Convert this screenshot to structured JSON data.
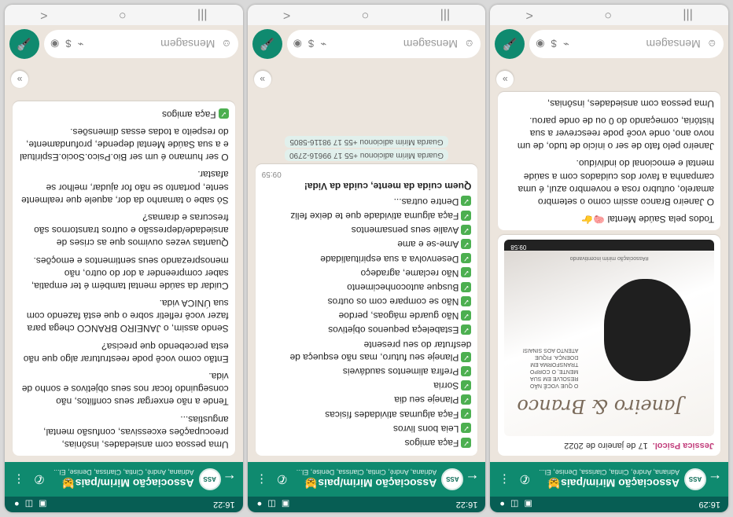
{
  "common": {
    "group_title": "Associação Mirim/pais😸",
    "members": "Adriana, André, Cintia, Clarissa, Denise, El...",
    "avatar_text": "ASS",
    "input_placeholder": "Mensagem",
    "nav": {
      "menu": "|||",
      "home": "○",
      "back": "<"
    }
  },
  "phones": [
    {
      "status_time": "16:29",
      "sender": "Jessica Psicol.",
      "date": "17 de janeiro de 2022",
      "poster": {
        "script": "Janeiro & Branco",
        "text": "O QUE VOCÊ NÃO RESOLVE EM SUA MENTE, O CORPO TRANSFORMA EM DOENÇA. FIQUE ATENTO AOS SINAIS!",
        "footer": "#Associação mirim incentivando",
        "time": "09:58"
      },
      "heading": "Todos pela Saúde Mental 🧠👉",
      "text": "O Janeiro Branco assim como o setembro amarelo, outubro rosa e novembro azul, é uma campanha a favor dos cuidados com a saúde mental e emocional do indivíduo.",
      "text2": "Janeiro pelo fato de ser o início de tudo, de um novo ano, onde você pode reescrever a sua história, começando do 0 ou de onde parou.",
      "text3": "Uma pessoa com ansiedades, insônias,"
    },
    {
      "status_time": "16:22",
      "list": [
        "Faça amigos",
        "Leia bons livros",
        "Faça algumas atividades físicas",
        "Planeje seu dia",
        "Sorria",
        "Prefira alimentos saudáveis",
        "Planeje seu futuro, mas não esqueça de desfrutar do seu presente",
        "Estabeleça pequenos objetivos",
        "Não guarde mágoas, perdoe",
        "Não se compare com os outros",
        "Busque autoconhecimento",
        "Não reclame, agradeço",
        "Desenvolva a sua espiritualidade",
        "Ame-se e ame",
        "Avalie seus pensamentos",
        "Faça alguma atividade que te deixe feliz",
        "Dentre outras..."
      ],
      "closing": "Quem cuida da mente, cuida da Vida!",
      "time": "09:59",
      "system1": "Guarda Mirim adicionou +55 17 99616-2790",
      "system2": "Guarda Mirim adicionou +55 17 98116-5805"
    },
    {
      "status_time": "16:22",
      "paras": [
        "Uma pessoa com ansiedades, insônias, preocupações excessivas, confusão mental, angustias...",
        "Tende a não enxergar seus conflitos, não conseguindo focar nos seus objetivos e sonho de vida.",
        "Então como você pode reestruturar algo que não esta percebendo que precisa?",
        "Sendo assim, o JANEIRO BRANCO chega para fazer você refletir sobre o que está fazendo com sua ÚNICA vida.",
        "Cuidar da saúde mental também é ter empatia, saber compreender a dor do outro, não menosprezando seus sentimentos e emoções.",
        "Quantas vezes ouvimos que as crises de ansiedade/depressão e outros transtornos são frescuras e dramas?",
        "Só sabe o tamanho da dor, aquele que realmente sente, portanto se não for ajudar, melhor se afastar.",
        "O ser humano é um ser Bio.Psico.Socio.Espiritual e a sua Saúde Mental depende, profundamente, do respeito a todas essas dimensões."
      ],
      "last_item": "Faça amigos"
    }
  ]
}
